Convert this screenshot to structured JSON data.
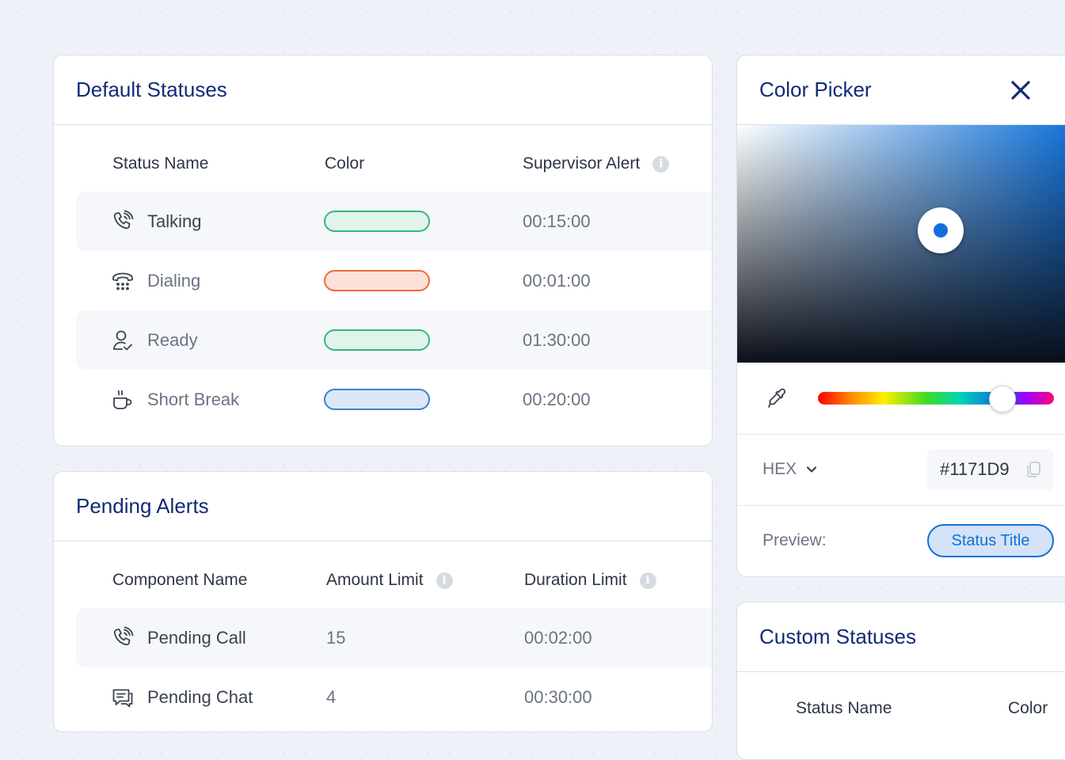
{
  "default_statuses": {
    "title": "Default Statuses",
    "columns": {
      "name": "Status Name",
      "color": "Color",
      "alert": "Supervisor Alert"
    },
    "rows": [
      {
        "icon": "phone-talking-icon",
        "name": "Talking",
        "color_fill": "#e1f4ec",
        "color_border": "#34b77d",
        "alert": "00:15:00"
      },
      {
        "icon": "phone-dialing-icon",
        "name": "Dialing",
        "color_fill": "#fde0d8",
        "color_border": "#ef6a3c",
        "alert": "00:01:00"
      },
      {
        "icon": "user-ready-icon",
        "name": "Ready",
        "color_fill": "#e1f4ec",
        "color_border": "#34b77d",
        "alert": "01:30:00"
      },
      {
        "icon": "coffee-cup-icon",
        "name": "Short Break",
        "color_fill": "#dce8f7",
        "color_border": "#3f7fd0",
        "alert": "00:20:00"
      }
    ]
  },
  "pending_alerts": {
    "title": "Pending Alerts",
    "columns": {
      "name": "Component Name",
      "amount": "Amount Limit",
      "duration": "Duration Limit"
    },
    "rows": [
      {
        "icon": "phone-call-icon",
        "name": "Pending Call",
        "amount": "15",
        "duration": "00:02:00"
      },
      {
        "icon": "chat-icon",
        "name": "Pending Chat",
        "amount": "4",
        "duration": "00:30:00"
      }
    ]
  },
  "color_picker": {
    "title": "Color Picker",
    "selected_color": "#1171d9",
    "hex_format": "HEX",
    "hex_value": "#1171D9",
    "preview_label": "Preview:",
    "preview_chip": "Status Title"
  },
  "custom_statuses": {
    "title": "Custom Statuses",
    "columns": {
      "name": "Status Name",
      "color": "Color"
    }
  },
  "colors": {
    "title": "#112b75",
    "accent": "#1171d9"
  }
}
